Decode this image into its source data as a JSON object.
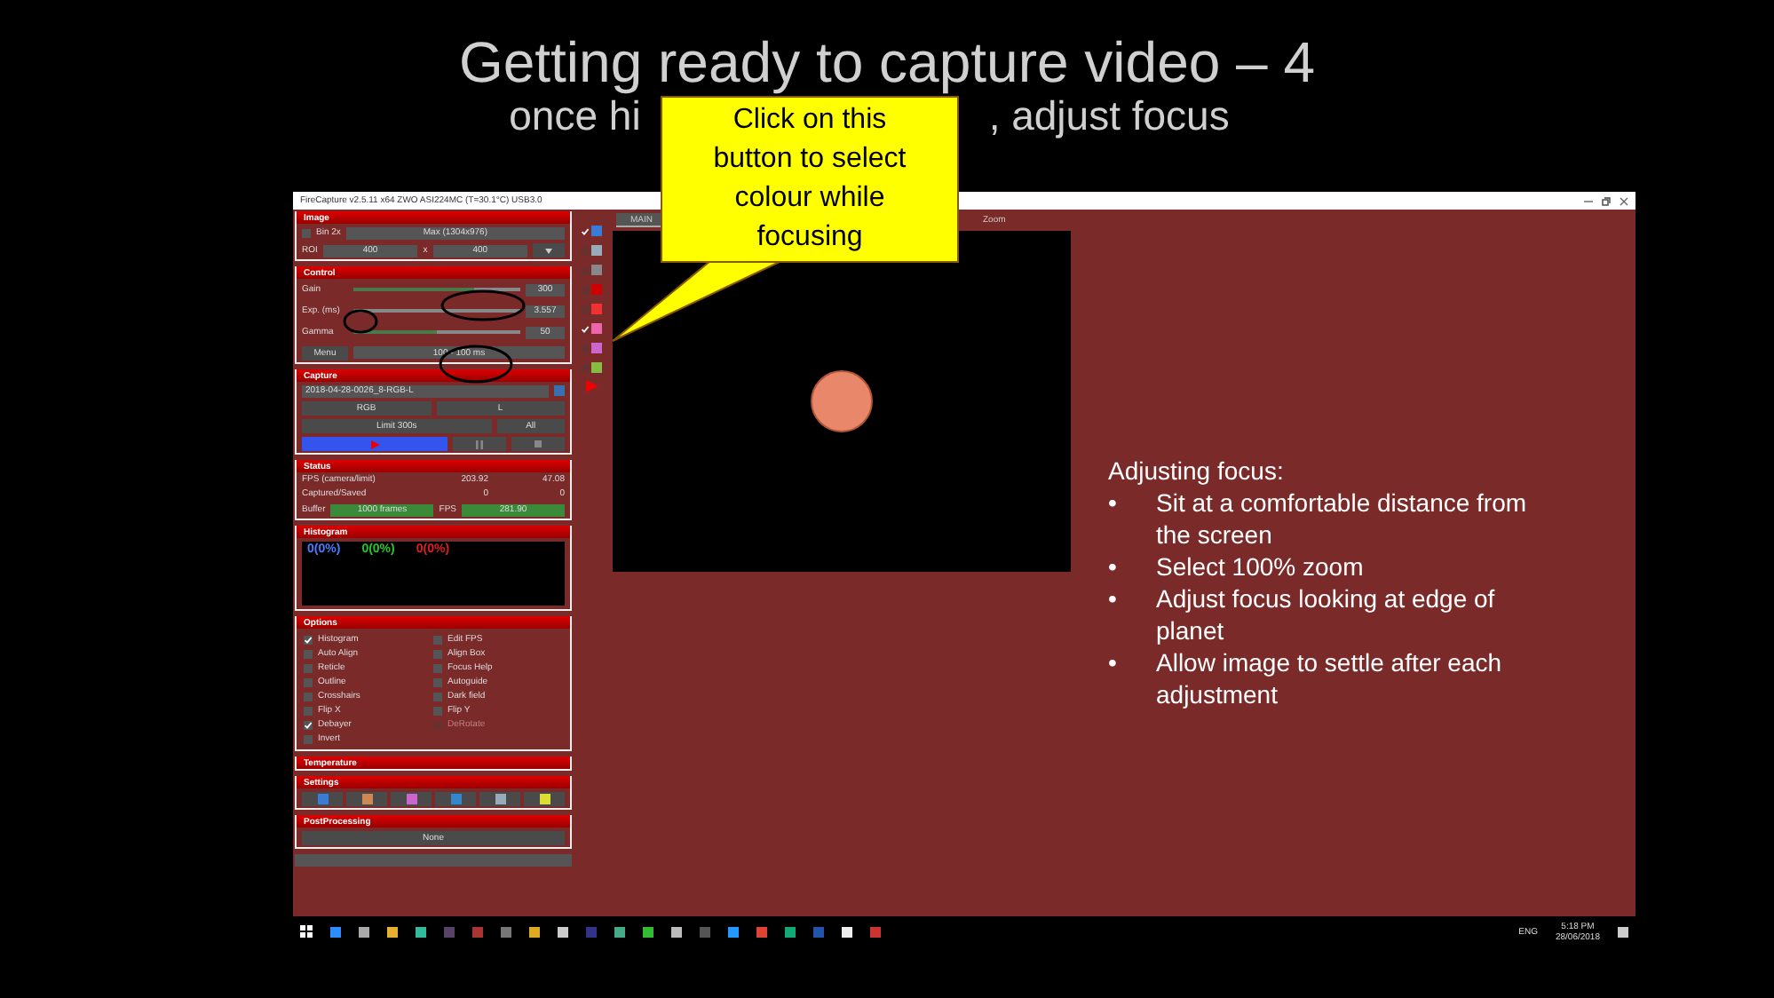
{
  "slide": {
    "title": "Getting ready to capture video – 4",
    "subtitle_left": "once hi",
    "subtitle_right": ", adjust focus"
  },
  "callout": {
    "text": "Click on this button to select colour while focusing"
  },
  "app": {
    "window_title": "FireCapture v2.5.11 x64   ZWO ASI224MC (T=30.1°C) USB3.0",
    "image_panel": {
      "title": "Image",
      "bin_checked": false,
      "bin": "Bin 2x",
      "max": "Max (1304x976)",
      "roi": "ROI",
      "roi_w": "400",
      "x": "x",
      "roi_h": "400"
    },
    "control_panel": {
      "title": "Control",
      "sliders": [
        {
          "label": "Gain",
          "value": "300",
          "level": 0.72
        },
        {
          "label": "Exp. (ms)",
          "value": "3.557",
          "level": 0.02
        },
        {
          "label": "Gamma",
          "value": "50",
          "level": 0.5
        }
      ],
      "menu": "Menu",
      "range": "100 - 100 ms"
    },
    "capture_panel": {
      "title": "Capture",
      "filename": "2018-04-28-0026_8-RGB-L",
      "mode_a": "RGB",
      "mode_b": "L",
      "limit": "Limit 300s",
      "all": "All"
    },
    "status_panel": {
      "title": "Status",
      "rows": [
        {
          "label": "FPS (camera/limit)",
          "a": "203.92",
          "b": "47.08"
        },
        {
          "label": "Captured/Saved",
          "a": "0",
          "b": "0"
        }
      ],
      "buffer": "Buffer",
      "buffer_value": "1000 frames",
      "fps": "FPS",
      "fps_value": "281.90"
    },
    "histogram_panel": {
      "title": "Histogram",
      "readings": [
        {
          "text": "0(0%)",
          "color": "#4a7dff"
        },
        {
          "text": "0(0%)",
          "color": "#28c828"
        },
        {
          "text": "0(0%)",
          "color": "#e02020"
        }
      ]
    },
    "options_panel": {
      "title": "Options",
      "options": [
        {
          "label": "Histogram",
          "checked": true,
          "disabled": false
        },
        {
          "label": "Edit FPS",
          "checked": false,
          "disabled": false
        },
        {
          "label": "Auto Align",
          "checked": false,
          "disabled": false
        },
        {
          "label": "Align Box",
          "checked": false,
          "disabled": false
        },
        {
          "label": "Reticle",
          "checked": false,
          "disabled": false
        },
        {
          "label": "Focus Help",
          "checked": false,
          "disabled": false
        },
        {
          "label": "Outline",
          "checked": false,
          "disabled": false
        },
        {
          "label": "Autoguide",
          "checked": false,
          "disabled": false
        },
        {
          "label": "Crosshairs",
          "checked": false,
          "disabled": false
        },
        {
          "label": "Dark field",
          "checked": false,
          "disabled": false
        },
        {
          "label": "Flip X",
          "checked": false,
          "disabled": false
        },
        {
          "label": "Flip Y",
          "checked": false,
          "disabled": false
        },
        {
          "label": "Debayer",
          "checked": true,
          "disabled": false
        },
        {
          "label": "DeRotate",
          "checked": false,
          "disabled": true
        },
        {
          "label": "Invert",
          "checked": false,
          "disabled": false
        }
      ]
    },
    "temperature_panel": {
      "title": "Temperature"
    },
    "settings_panel": {
      "title": "Settings"
    },
    "post_panel": {
      "title": "PostProcessing",
      "value": "None"
    },
    "toolbar": [
      {
        "checked": true
      },
      {
        "checked": false
      },
      {
        "checked": false
      },
      {
        "checked": false
      },
      {
        "checked": false
      },
      {
        "checked": true
      },
      {
        "checked": false
      },
      {
        "checked": false
      }
    ],
    "tabs": [
      {
        "label": "MAIN",
        "selected": true
      },
      {
        "label": "Zoom",
        "selected": false
      }
    ],
    "taskbar": {
      "lang": "ENG",
      "time": "5:18 PM",
      "date": "28/06/2018"
    }
  },
  "notes": {
    "heading": "Adjusting focus:",
    "bullets": [
      {
        "marker": "•",
        "text": "Sit at a comfortable distance from the screen"
      },
      {
        "marker": "•",
        "text": "Select 100% zoom"
      },
      {
        "marker": "•",
        "text": "Adjust focus looking at edge of planet"
      },
      {
        "marker": "•",
        "text": "Allow image to settle after each adjustment"
      }
    ]
  }
}
